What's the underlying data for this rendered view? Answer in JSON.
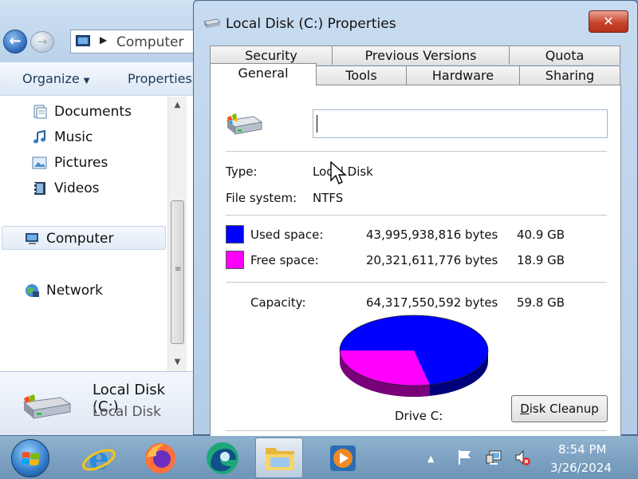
{
  "explorer": {
    "address": "Computer",
    "toolbar": {
      "organize": "Organize",
      "properties": "Properties"
    },
    "nav_items": [
      {
        "label": "Documents",
        "icon": "documents-icon"
      },
      {
        "label": "Music",
        "icon": "music-icon"
      },
      {
        "label": "Pictures",
        "icon": "pictures-icon"
      },
      {
        "label": "Videos",
        "icon": "videos-icon"
      },
      {
        "label": "Computer",
        "icon": "computer-icon",
        "selected": true
      },
      {
        "label": "Network",
        "icon": "network-icon"
      }
    ],
    "details": {
      "name": "Local Disk (C:)",
      "type": "Local Disk"
    }
  },
  "dialog": {
    "title": "Local Disk (C:) Properties",
    "close": "✕",
    "tabs_back": [
      "Security",
      "Previous Versions",
      "Quota"
    ],
    "tabs_front": [
      "General",
      "Tools",
      "Hardware",
      "Sharing"
    ],
    "active_tab": "General",
    "name_value": "",
    "type_label": "Type:",
    "type_value": "Local Disk",
    "fs_label": "File system:",
    "fs_value": "NTFS",
    "used_label": "Used space:",
    "used_bytes": "43,995,938,816 bytes",
    "used_gb": "40.9 GB",
    "used_color": "#0000ff",
    "free_label": "Free space:",
    "free_bytes": "20,321,611,776 bytes",
    "free_gb": "18.9 GB",
    "free_color": "#ff00ff",
    "capacity_label": "Capacity:",
    "capacity_bytes": "64,317,550,592 bytes",
    "capacity_gb": "59.8 GB",
    "drive_label": "Drive C:",
    "cleanup_prefix": "D",
    "cleanup_rest": "isk Cleanup"
  },
  "taskbar": {
    "apps": [
      "internet-explorer-icon",
      "firefox-icon",
      "edge-icon",
      "file-explorer-icon",
      "media-player-icon"
    ],
    "time": "8:54 PM",
    "date": "3/26/2024"
  }
}
